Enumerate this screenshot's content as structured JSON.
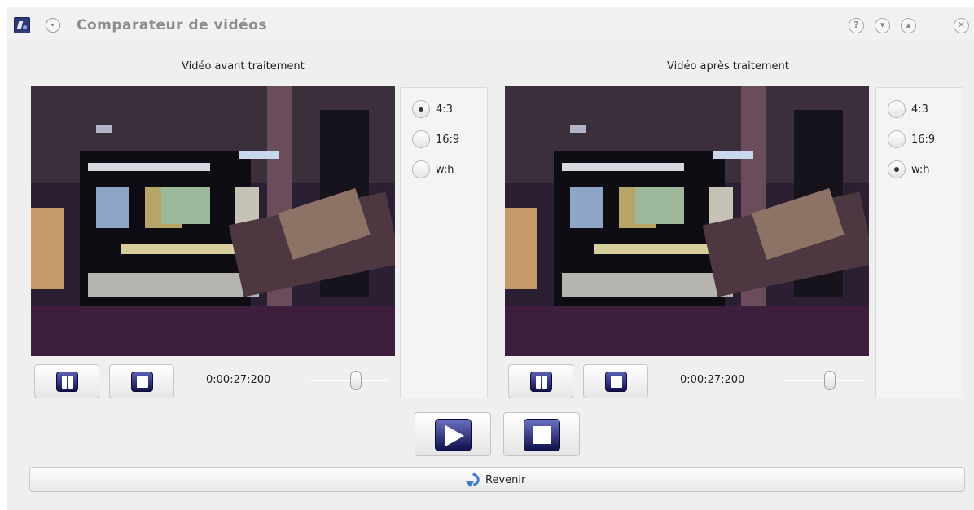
{
  "window": {
    "title": "Comparateur de vidéos"
  },
  "title_buttons": {
    "help": "?",
    "minimize": "▾",
    "maximize": "▴",
    "close": "✕"
  },
  "left": {
    "label": "Vidéo avant traitement",
    "ratios": [
      {
        "label": "4:3",
        "checked": true
      },
      {
        "label": "16:9",
        "checked": false
      },
      {
        "label": "w:h",
        "checked": false
      }
    ],
    "timecode": "0:00:27:200",
    "volume_fraction": 0.6
  },
  "right": {
    "label": "Vidéo après traitement",
    "ratios": [
      {
        "label": "4:3",
        "checked": false
      },
      {
        "label": "16:9",
        "checked": false
      },
      {
        "label": "w:h",
        "checked": true
      }
    ],
    "timecode": "0:00:27:200",
    "volume_fraction": 0.6
  },
  "back_button": {
    "label": "Revenir"
  },
  "colors": {
    "button_icon": "#1a1a5e",
    "back_icon": "#3d7fc9"
  }
}
